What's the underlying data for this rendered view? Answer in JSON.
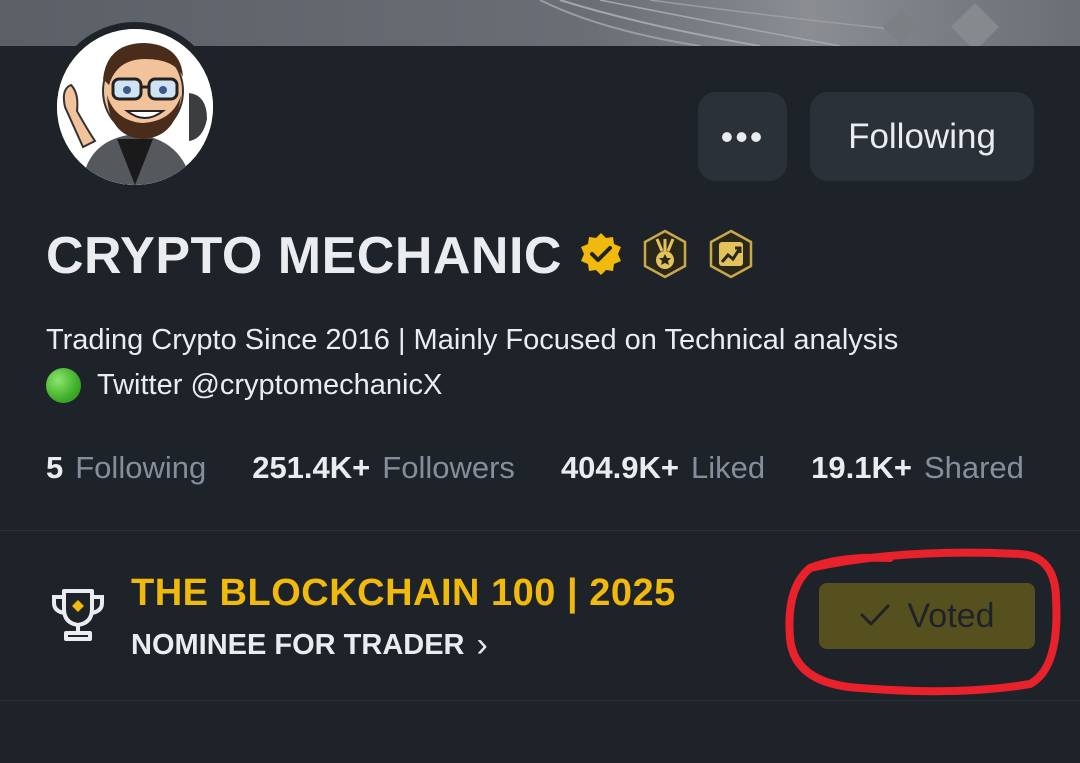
{
  "profile": {
    "name": "CRYPTO MECHANIC",
    "bio_line1": "Trading Crypto Since 2016 | Mainly Focused on Technical analysis",
    "bio_line2": "Twitter @cryptomechanicX"
  },
  "actions": {
    "more_label": "•••",
    "following_label": "Following"
  },
  "stats": [
    {
      "value": "5",
      "label": "Following"
    },
    {
      "value": "251.4K+",
      "label": "Followers"
    },
    {
      "value": "404.9K+",
      "label": "Liked"
    },
    {
      "value": "19.1K+",
      "label": "Shared"
    }
  ],
  "award": {
    "title": "THE BLOCKCHAIN 100 | 2025",
    "subtitle": "NOMINEE FOR TRADER",
    "chevron": "›",
    "vote_label": "Voted"
  },
  "icons": {
    "verified": "verified-badge-icon",
    "medal": "medal-badge-icon",
    "chart": "chart-badge-icon",
    "trophy": "trophy-icon",
    "check": "check-icon"
  },
  "colors": {
    "background": "#1e2329",
    "brand_yellow": "#f0b90b",
    "button_bg": "#2b3139",
    "muted_text": "#848e9c",
    "voted_bg": "#56501f",
    "annotation_red": "#e8212b"
  }
}
